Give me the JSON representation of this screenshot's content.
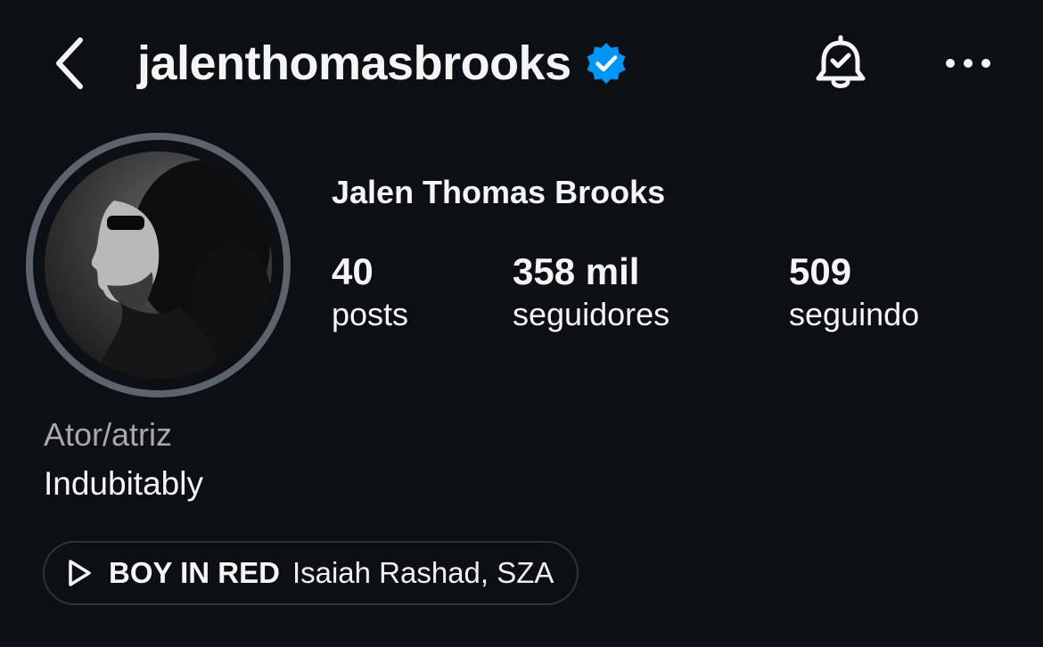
{
  "header": {
    "username": "jalenthomasbrooks",
    "verified": true,
    "accent_color": "#0095f6"
  },
  "profile": {
    "display_name": "Jalen Thomas Brooks",
    "stats": [
      {
        "value": "40",
        "label": "posts"
      },
      {
        "value": "358 mil",
        "label": "seguidores"
      },
      {
        "value": "509",
        "label": "seguindo"
      }
    ],
    "category": "Ator/atriz",
    "bio": "Indubitably"
  },
  "music": {
    "title": "BOY IN RED",
    "artist": "Isaiah Rashad, SZA"
  },
  "icons": {
    "back": "chevron-left-icon",
    "verified": "verified-badge-icon",
    "notifications": "bell-check-icon",
    "more": "more-horizontal-icon",
    "play": "play-icon"
  },
  "colors": {
    "background": "#0c1014",
    "text": "#f5f5f5",
    "muted": "#a8a8a8",
    "ring": "#5b636c"
  }
}
